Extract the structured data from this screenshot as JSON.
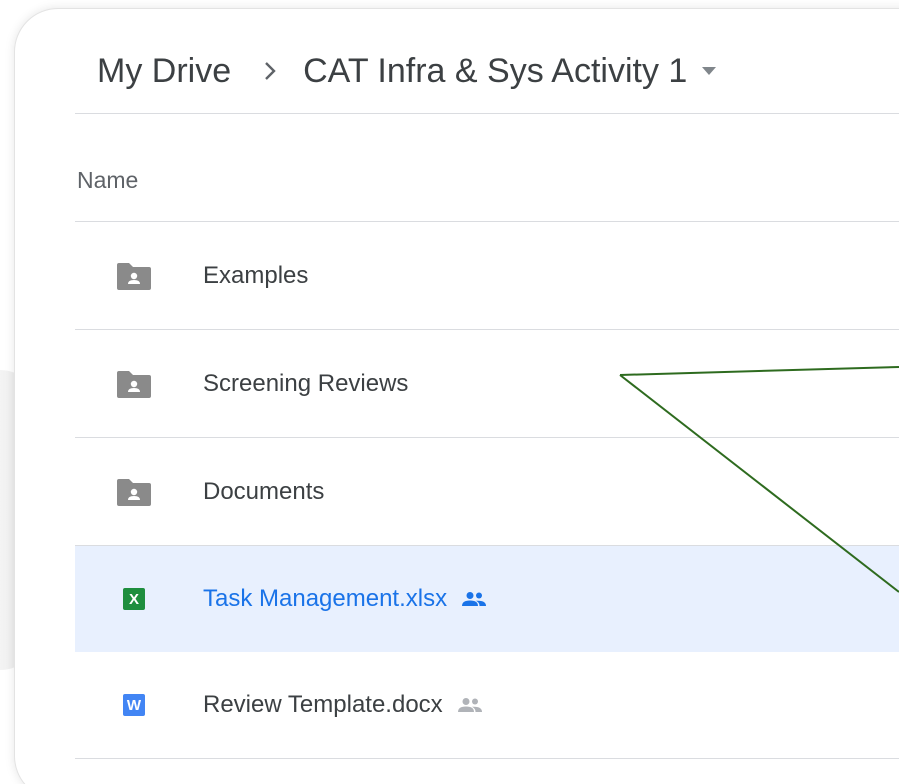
{
  "breadcrumb": {
    "root": "My Drive",
    "current": "CAT Infra & Sys Activity 1"
  },
  "list": {
    "header": "Name",
    "rows": [
      {
        "name": "Examples",
        "icon": "shared-folder-icon",
        "shared": false,
        "selected": false
      },
      {
        "name": "Screening Reviews",
        "icon": "shared-folder-icon",
        "shared": false,
        "selected": false
      },
      {
        "name": "Documents",
        "icon": "shared-folder-icon",
        "shared": false,
        "selected": false
      },
      {
        "name": "Task Management.xlsx",
        "icon": "excel-file-icon",
        "badge": "X",
        "shared": true,
        "selected": true
      },
      {
        "name": "Review Template.docx",
        "icon": "word-file-icon",
        "badge": "W",
        "shared": true,
        "selected": false
      }
    ]
  },
  "colors": {
    "text": "#3c4043",
    "muted": "#5f6368",
    "divider": "#dadce0",
    "selected_bg": "#e8f0fe",
    "selected_text": "#1a73e8",
    "folder": "#8a8a8a",
    "excel": "#1e8e3e",
    "word": "#4285f4",
    "annotation": "#2e6b1f"
  }
}
